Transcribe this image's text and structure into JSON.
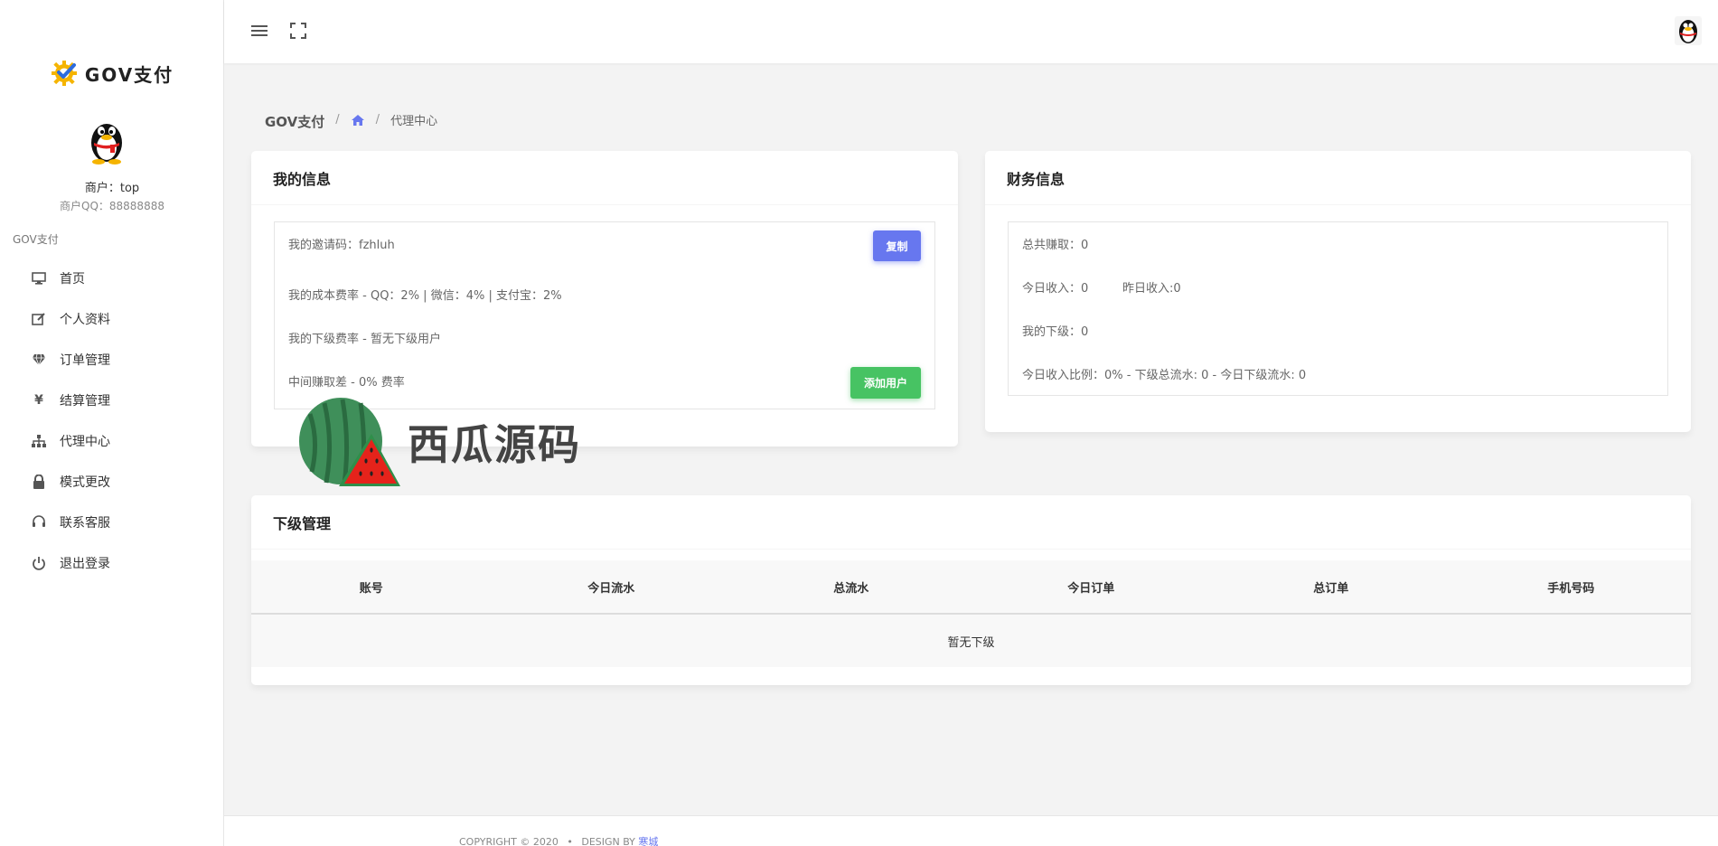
{
  "brand": {
    "name": "GOV支付"
  },
  "user": {
    "merchant": "商户：top",
    "qq": "商户QQ：88888888"
  },
  "nav": {
    "title": "GOV支付",
    "items": [
      {
        "label": "首页",
        "icon": "monitor-icon"
      },
      {
        "label": "个人资料",
        "icon": "edit-icon"
      },
      {
        "label": "订单管理",
        "icon": "diamond-icon"
      },
      {
        "label": "结算管理",
        "icon": "yen-icon"
      },
      {
        "label": "代理中心",
        "icon": "sitemap-icon"
      },
      {
        "label": "模式更改",
        "icon": "lock-icon"
      },
      {
        "label": "联系客服",
        "icon": "headset-icon"
      },
      {
        "label": "退出登录",
        "icon": "power-icon"
      }
    ]
  },
  "breadcrumb": {
    "root": "GOV支付",
    "current": "代理中心"
  },
  "my_info": {
    "title": "我的信息",
    "invite": "我的邀请码：fzhluh",
    "cost_rate": "我的成本费率 - QQ：2% | 微信：4% | 支付宝：2%",
    "sub_rate": "我的下级费率 - 暂无下级用户",
    "margin": "中间赚取差 - 0% 费率",
    "copy_label": "复制",
    "add_label": "添加用户"
  },
  "finance": {
    "title": "财务信息",
    "total": "总共赚取：0",
    "today": "今日收入：0",
    "yesterday": "昨日收入:0",
    "subs": "我的下级：0",
    "ratio": "今日收入比例：0% - 下级总流水: 0 - 今日下级流水: 0"
  },
  "subordinates": {
    "title": "下级管理",
    "columns": [
      "账号",
      "今日流水",
      "总流水",
      "今日订单",
      "总订单",
      "手机号码"
    ],
    "empty": "暂无下级"
  },
  "watermark": {
    "text": "西瓜源码"
  },
  "footer": {
    "copyright": "COPYRIGHT © 2020",
    "dot": "•",
    "design_by": "DESIGN BY",
    "author": "寒城"
  },
  "colors": {
    "primary": "#6777ef",
    "success": "#47c363",
    "background": "#f3f3f3"
  }
}
